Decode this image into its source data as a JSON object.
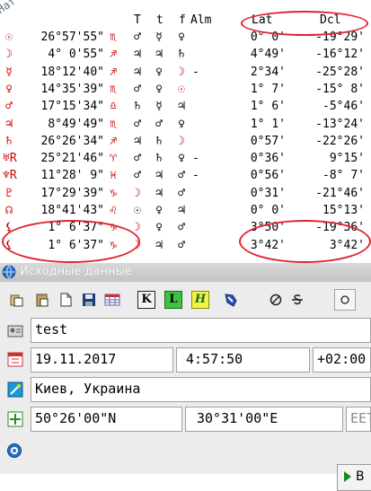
{
  "table": {
    "corner_label": "Нат",
    "headers": {
      "T": "T",
      "t": "t",
      "f": "f",
      "alm": "Alm",
      "lat": "Lat",
      "dcl": "Dcl"
    },
    "rows": [
      {
        "planet": "☉",
        "deg": "26°57'55\"",
        "sign": "♏",
        "T": "♂",
        "t": "☿",
        "f": "♀",
        "alm": "",
        "lat": "0° 0'",
        "dcl": "-19°29'"
      },
      {
        "planet": "☽",
        "deg": "4° 0'55\"",
        "sign": "♐",
        "T": "♃",
        "t": "♃",
        "f": "♄",
        "alm": "",
        "lat": "4°49'",
        "dcl": "-16°12'"
      },
      {
        "planet": "☿",
        "deg": "18°12'40\"",
        "sign": "♐",
        "T": "♃",
        "t": "♀",
        "f": "☽",
        "alm": "-",
        "lat": "2°34'",
        "dcl": "-25°28'"
      },
      {
        "planet": "♀",
        "deg": "14°35'39\"",
        "sign": "♏",
        "T": "♂",
        "t": "♀",
        "f": "☉",
        "alm": "",
        "lat": "1° 7'",
        "dcl": "-15° 8'"
      },
      {
        "planet": "♂",
        "deg": "17°15'34\"",
        "sign": "♎",
        "T": "♄",
        "t": "☿",
        "f": "♃",
        "alm": "",
        "lat": "1° 6'",
        "dcl": "-5°46'"
      },
      {
        "planet": "♃",
        "deg": "8°49'49\"",
        "sign": "♏",
        "T": "♂",
        "t": "♂",
        "f": "♀",
        "alm": "",
        "lat": "1° 1'",
        "dcl": "-13°24'"
      },
      {
        "planet": "♄",
        "deg": "26°26'34\"",
        "sign": "♐",
        "T": "♃",
        "t": "♄",
        "f": "☽",
        "alm": "",
        "lat": "0°57'",
        "dcl": "-22°26'"
      },
      {
        "planet": "♅R",
        "deg": "25°21'46\"",
        "sign": "♈",
        "T": "♂",
        "t": "♄",
        "f": "♀",
        "alm": "-",
        "lat": "0°36'",
        "dcl": "9°15'"
      },
      {
        "planet": "♆R",
        "deg": "11°28' 9\"",
        "sign": "♓",
        "T": "♂",
        "t": "♃",
        "f": "♂",
        "alm": "-",
        "lat": "0°56'",
        "dcl": "-8° 7'"
      },
      {
        "planet": "♇",
        "deg": "17°29'39\"",
        "sign": "♑",
        "T": "☽",
        "t": "♃",
        "f": "♂",
        "alm": "",
        "lat": "0°31'",
        "dcl": "-21°46'"
      },
      {
        "planet": "☊",
        "deg": "18°41'43\"",
        "sign": "♌",
        "T": "☉",
        "t": "♀",
        "f": "♃",
        "alm": "",
        "lat": "0° 0'",
        "dcl": "15°13'"
      },
      {
        "planet": "⚸",
        "deg": "1° 6'37\"",
        "sign": "♑",
        "T": "☽",
        "t": "♀",
        "f": "♂",
        "alm": "",
        "lat": "3°50'",
        "dcl": "-19°36'"
      },
      {
        "planet": "⚸",
        "deg": "1° 6'37\"",
        "sign": "♑",
        "T": "☽",
        "t": "♃",
        "f": "♂",
        "alm": "",
        "lat": "3°42'",
        "dcl": "3°42'"
      }
    ]
  },
  "panel": {
    "title": "Исходные данные"
  },
  "toolbar": {
    "icons": [
      "clipboard-copy-icon",
      "clipboard-paste-icon",
      "new-document-icon",
      "save-disk-icon",
      "table-icon",
      "k-button-icon",
      "l-button-icon",
      "h-button-icon",
      "shield-icon",
      "cancel-icon",
      "strikethrough-s-icon",
      "circle-icon"
    ],
    "k_label": "K",
    "l_label": "L",
    "h_label": "H"
  },
  "form": {
    "name_value": "test",
    "date_value": "19.11.2017",
    "time_value": "4:57:50",
    "tz_value": "+02:00",
    "place_value": "Киев, Украина",
    "lat_value": "50°26'00\"N",
    "lon_value": "30°31'00\"E",
    "extra_value": "EET",
    "go_label": "В"
  },
  "colors": {
    "sign_red": "#cc0000",
    "highlight_oval": "#e0232e"
  }
}
